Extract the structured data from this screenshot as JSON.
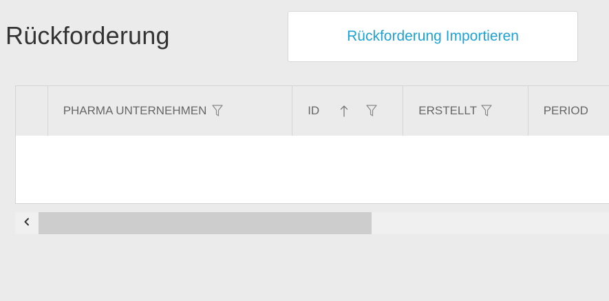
{
  "page": {
    "title": "Rückforderung",
    "import_button_label": "Rückforderung Importieren"
  },
  "grid": {
    "columns": [
      {
        "label": "PHARMA UNTERNEHMEN",
        "filter": true,
        "sort": null
      },
      {
        "label": "ID",
        "filter": true,
        "sort": "ascending"
      },
      {
        "label": "ERSTELLT",
        "filter": true,
        "sort": null
      },
      {
        "label": "PERIOD",
        "filter": false,
        "sort": null
      }
    ],
    "rows": []
  },
  "icons": {
    "filter": "filter-icon",
    "sort_ascending": "sort-ascending-icon",
    "scroll_left": "chevron-left-icon"
  },
  "colors": {
    "accent": "#1ea2d6",
    "background": "#ebebeb",
    "header_text": "#666666",
    "title_text": "#333333"
  }
}
